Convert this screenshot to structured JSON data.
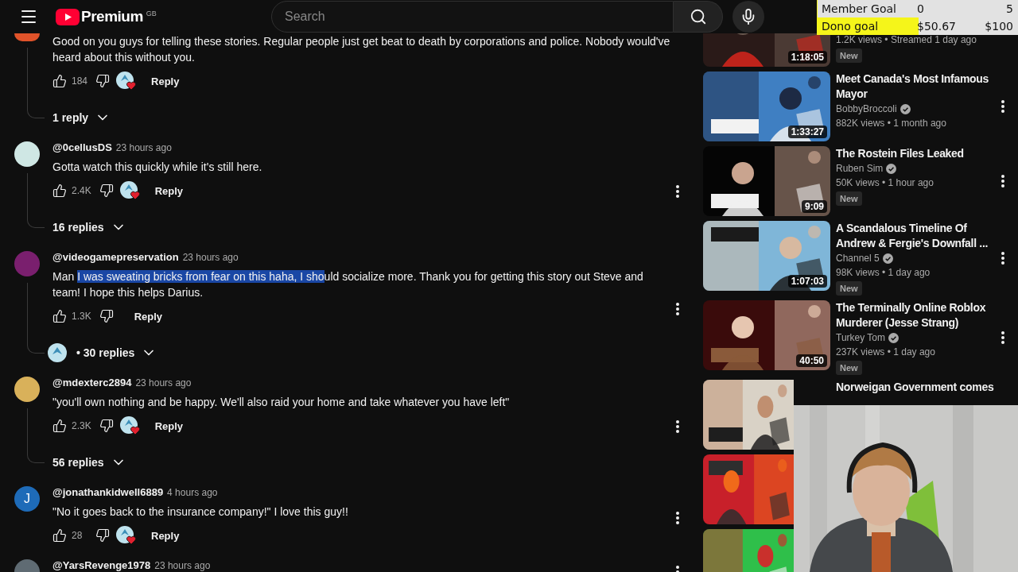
{
  "header": {
    "logo": "Premium",
    "region": "GB",
    "search": {
      "placeholder": "Search"
    }
  },
  "goals": [
    {
      "label": "Member Goal",
      "current": "0",
      "target": "5",
      "level": 0
    },
    {
      "label": "Dono goal",
      "current": "$50.67",
      "target": "$100",
      "level": 0.5067
    }
  ],
  "comments": [
    {
      "kind": "partial",
      "avatar": {
        "color": "#e0532a"
      },
      "text_parts": [
        {
          "text": "Good on you guys for telling these stories. Regular people just get beat to death by corporations and police. Nobody would've heard about this without you.",
          "selected": false
        }
      ],
      "likes": "184",
      "creator_heart": true,
      "reply_label": "Reply",
      "replies": {
        "label": "1 reply",
        "creator_replied": false
      }
    },
    {
      "kind": "full",
      "author": "@0cellusDS",
      "time": "23 hours ago",
      "avatar": {
        "color": "#cfe7e4"
      },
      "text_parts": [
        {
          "text": "Gotta watch this quickly while it's still here.",
          "selected": false
        }
      ],
      "likes": "2.4K",
      "creator_heart": true,
      "reply_label": "Reply",
      "replies": {
        "label": "16 replies",
        "creator_replied": false
      }
    },
    {
      "kind": "full",
      "author": "@videogamepreservation",
      "time": "23 hours ago",
      "avatar": {
        "color": "#7a1f6e"
      },
      "text_parts": [
        {
          "text": "Man ",
          "selected": false
        },
        {
          "text": "I was sweating bricks from fear on this haha, I sho",
          "selected": true
        },
        {
          "text": "uld socialize more. Thank you for getting this story out Steve and team! I hope this helps Darius.",
          "selected": false
        }
      ],
      "likes": "1.3K",
      "creator_heart": false,
      "reply_label": "Reply",
      "replies": {
        "label": "• 30 replies",
        "creator_replied": true
      }
    },
    {
      "kind": "full",
      "author": "@mdexterc2894",
      "time": "23 hours ago",
      "avatar": {
        "color": "#d9b15a"
      },
      "text_parts": [
        {
          "text": "\"you'll own nothing and be happy. We'll also raid your home and take whatever you have left\"",
          "selected": false
        }
      ],
      "likes": "2.3K",
      "creator_heart": true,
      "reply_label": "Reply",
      "replies": {
        "label": "56 replies",
        "creator_replied": false
      }
    },
    {
      "kind": "full",
      "author": "@jonathankidwell6889",
      "time": "4 hours ago",
      "avatar": {
        "color": "#1e6bb8",
        "letter": "J"
      },
      "text_parts": [
        {
          "text": "\"No it goes back to the insurance company!\" I love this guy!!",
          "selected": false
        }
      ],
      "likes": "28",
      "creator_heart": true,
      "reply_label": "Reply"
    },
    {
      "kind": "full",
      "author": "@YarsRevenge1978",
      "time": "23 hours ago",
      "avatar": {
        "color": "#5f6b73"
      }
    }
  ],
  "sidebar": {
    "items": [
      {
        "thumbnail": {
          "kind": "picture",
          "duration": "1:18:05"
        },
        "meta": "1.2K views • Streamed 1 day ago",
        "badge": "New"
      },
      {
        "thumbnail": {
          "kind": "picture",
          "duration": "1:33:27"
        },
        "title": "Meet Canada's Most Infamous Mayor",
        "channel": "BobbyBroccoli",
        "verified": true,
        "meta": "882K views • 1 month ago"
      },
      {
        "thumbnail": {
          "kind": "picture",
          "duration": "9:09"
        },
        "title": "The Rostein Files Leaked",
        "channel": "Ruben Sim",
        "verified": true,
        "meta": "50K views • 1 hour ago",
        "badge": "New"
      },
      {
        "thumbnail": {
          "kind": "picture",
          "duration": "1:07:03"
        },
        "title": "A Scandalous Timeline Of Andrew & Fergie's Downfall ...",
        "channel": "Channel 5",
        "verified": true,
        "meta": "98K views • 1 day ago",
        "badge": "New"
      },
      {
        "thumbnail": {
          "kind": "picture",
          "duration": "40:50"
        },
        "title": "The Terminally Online Roblox Murderer (Jesse Strang)",
        "channel": "Turkey Tom",
        "verified": true,
        "meta": "237K views • 1 day ago",
        "badge": "New"
      },
      {
        "thumbnail": {
          "kind": "picture"
        },
        "title": "Norweigan Government comes"
      },
      {
        "thumbnail": {
          "kind": "picture"
        }
      },
      {
        "thumbnail": {
          "kind": "picture"
        }
      }
    ]
  },
  "webcam": {
    "kind": "picture"
  }
}
